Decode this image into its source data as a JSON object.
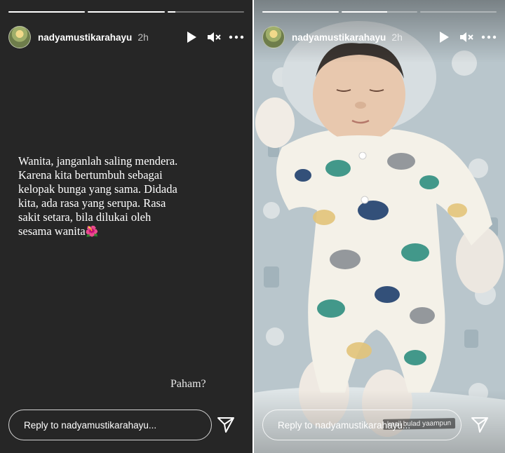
{
  "stories": [
    {
      "progress": [
        1,
        1,
        0.1
      ],
      "username": "nadyamustikarahayu",
      "time": "2h",
      "text_lines": [
        "Wanita, janganlah saling mendera.",
        "Karena kita bertumbuh sebagai",
        "kelopak bunga yang sama. Didada",
        "kita, ada rasa yang serupa. Rasa",
        "sakit setara, bila dilukai oleh",
        "sesama wanita"
      ],
      "flower_emoji": "🌺",
      "caption": "Paham?",
      "reply_placeholder": "Reply to nadyamustikarahayu..."
    },
    {
      "progress": [
        1,
        0.6,
        0
      ],
      "username": "nadyamustikarahayu",
      "time": "2h",
      "sticker_text": "kecil bulad yaampun",
      "reply_placeholder": "Reply to nadyamustikarahayu..."
    }
  ],
  "icons": {
    "play": "play-icon",
    "mute": "speaker-muted-icon",
    "more": "more-icon",
    "send": "send-icon"
  }
}
